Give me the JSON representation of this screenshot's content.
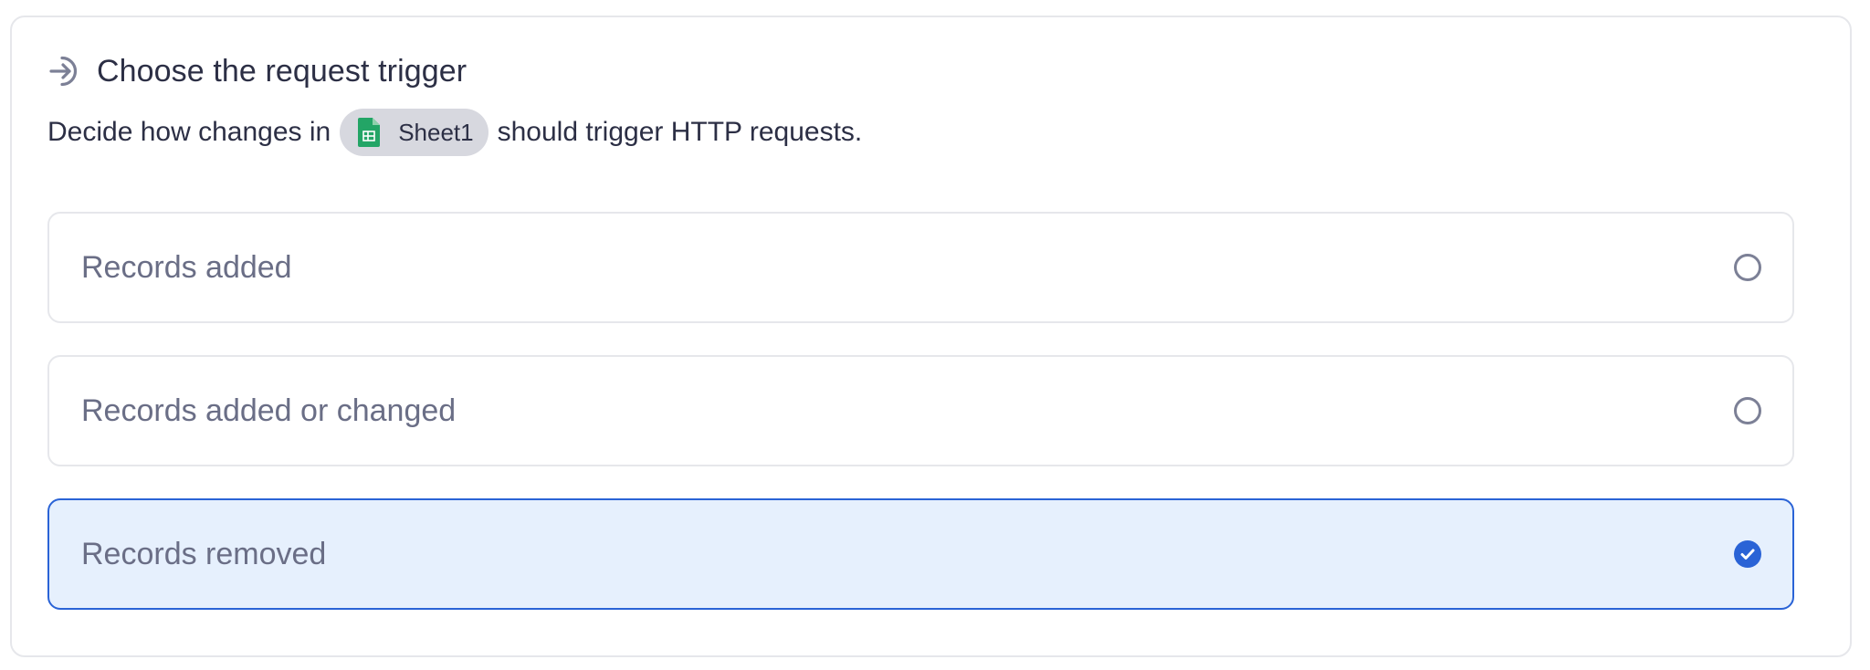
{
  "section": {
    "title": "Choose the request trigger",
    "icon": "arrow-right-to-circle-icon"
  },
  "description": {
    "prefix": "Decide how changes in",
    "sheet_name": "Sheet1",
    "sheet_icon": "google-sheets-icon",
    "suffix": "should trigger HTTP requests."
  },
  "options": [
    {
      "label": "Records added",
      "selected": false
    },
    {
      "label": "Records added or changed",
      "selected": false
    },
    {
      "label": "Records removed",
      "selected": true
    }
  ],
  "colors": {
    "accent": "#2a63d6",
    "selected_background": "#e6f0fd",
    "sheets_green": "#23a566"
  }
}
